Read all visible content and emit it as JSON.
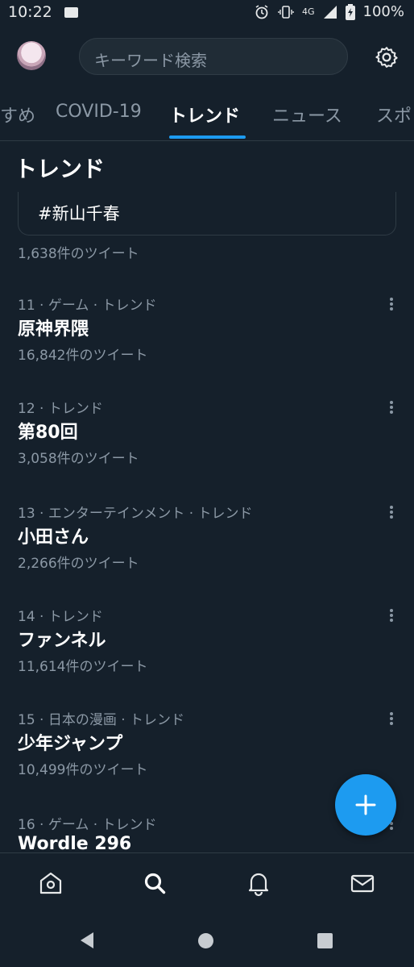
{
  "status_bar": {
    "time": "10:22",
    "network": "4G",
    "battery": "100%",
    "icons": [
      "mail-icon",
      "alarm-icon",
      "vibrate-icon",
      "signal-icon",
      "battery-icon"
    ]
  },
  "top_bar": {
    "search_placeholder": "キーワード検索",
    "icons": [
      "avatar",
      "gear-icon"
    ]
  },
  "tabs": [
    {
      "label": "すめ"
    },
    {
      "label": "COVID-19"
    },
    {
      "label": "トレンド",
      "active": true
    },
    {
      "label": "ニュース"
    },
    {
      "label": "スポ"
    }
  ],
  "section_title": "トレンド",
  "promoted": {
    "label": "#新山千春",
    "count": "1,638件のツイート"
  },
  "trends": [
    {
      "meta": "11 · ゲーム · トレンド",
      "name": "原神界隈",
      "count": "16,842件のツイート"
    },
    {
      "meta": "12 · トレンド",
      "name": "第80回",
      "count": "3,058件のツイート"
    },
    {
      "meta": "13 · エンターテインメント · トレンド",
      "name": "小田さん",
      "count": "2,266件のツイート"
    },
    {
      "meta": "14 · トレンド",
      "name": "ファンネル",
      "count": "11,614件のツイート"
    },
    {
      "meta": "15 · 日本の漫画 · トレンド",
      "name": "少年ジャンプ",
      "count": "10,499件のツイート"
    },
    {
      "meta": "16 · ゲーム · トレンド",
      "name": "Wordle 296",
      "count": ""
    }
  ],
  "fab_icon": "plus-icon",
  "bottom_nav": [
    "home-icon",
    "search-icon",
    "bell-icon",
    "mail-icon"
  ],
  "system_nav": [
    "back-icon",
    "home-circle-icon",
    "recents-icon"
  ],
  "colors": {
    "background": "#15202b",
    "accent": "#1d9bf0",
    "secondary_text": "#8b98a5",
    "divider": "#2f3b45"
  }
}
